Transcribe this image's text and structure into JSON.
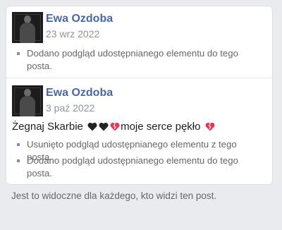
{
  "entries": [
    {
      "author": "Ewa Ozdoba",
      "date": "23 wrz 2022",
      "bullets": [
        "Dodano podgląd udostępnianego elementu do tego posta."
      ]
    },
    {
      "author": "Ewa Ozdoba",
      "date": "3 paź 2022",
      "message": "Żegnaj Skarbie 🖤🖤💔moje serce pękło 💔",
      "message_text": "Żegnaj Skarbie",
      "message_middle": "moje serce pękło",
      "bullets": [
        "Usunięto podgląd udostępnianego elementu z tego posta.",
        "Dodano podgląd udostępnianego elementu do tego posta."
      ]
    }
  ],
  "footer": "Jest to widoczne dla każdego, kto widzi ten post.",
  "colors": {
    "author": "#4b67a1",
    "bullet": "#7b8fbb",
    "broken_heart": "#e53951",
    "black_heart": "#222222"
  },
  "icons": [
    "black-heart-icon",
    "broken-heart-icon"
  ]
}
